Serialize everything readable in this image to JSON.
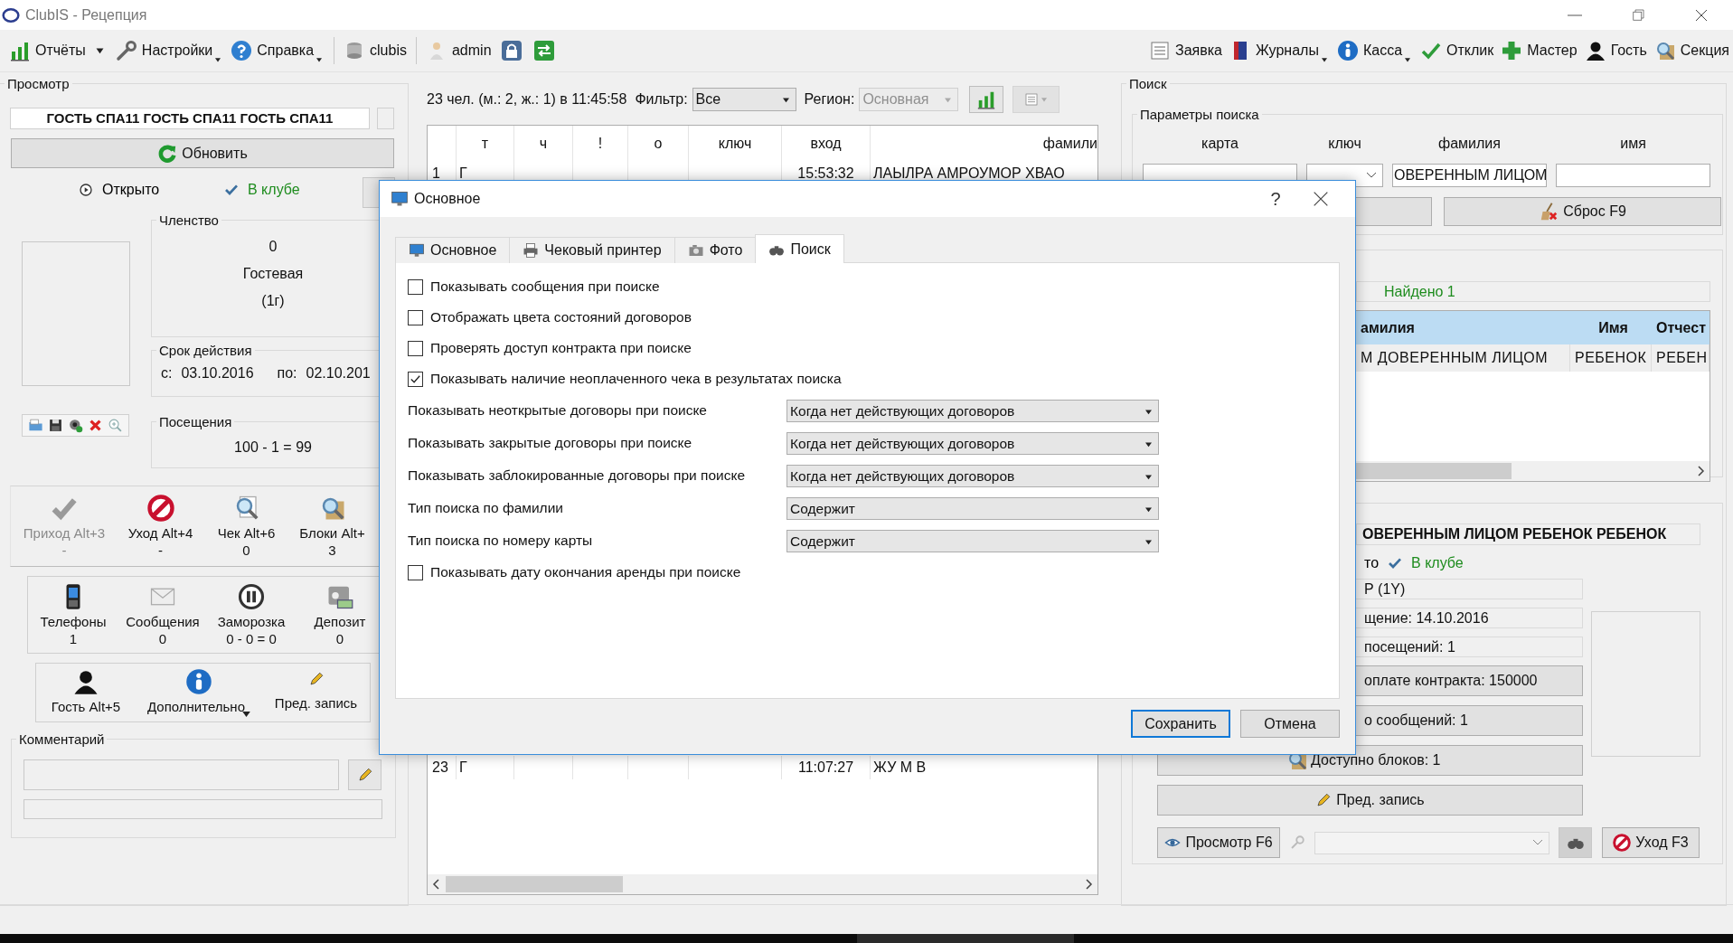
{
  "window": {
    "title": "ClubIS - Рецепция"
  },
  "toolbar_left": [
    {
      "label": "Отчёты",
      "menu": true
    },
    {
      "label": "Настройки",
      "menu": true
    },
    {
      "label": "Справка",
      "menu": true
    },
    {
      "label": "clubis",
      "menu": false
    },
    {
      "label": "admin",
      "menu": false
    }
  ],
  "toolbar_right": [
    {
      "label": "Заявка",
      "menu": false
    },
    {
      "label": "Журналы",
      "menu": true
    },
    {
      "label": "Касса",
      "menu": true
    },
    {
      "label": "Отклик",
      "menu": false
    },
    {
      "label": "Мастер",
      "menu": false
    },
    {
      "label": "Гость",
      "menu": false
    },
    {
      "label": "Секция",
      "menu": false
    }
  ],
  "view": {
    "title": "Просмотр",
    "name": "ГОСТЬ СПА11 ГОСТЬ СПА11 ГОСТЬ СПА11",
    "refresh": "Обновить",
    "status": [
      {
        "label": "Открыто",
        "color": "#000000"
      },
      {
        "label": "В клубе",
        "color": "#1e8c1e"
      }
    ],
    "membership": {
      "title": "Членство",
      "lines": [
        "0",
        "Гостевая",
        "(1г)"
      ]
    },
    "validity": {
      "title": "Срок действия",
      "from_label": "с:",
      "from": "03.10.2016",
      "to_label": "по:",
      "to": "02.10.201"
    },
    "visits": {
      "title": "Посещения",
      "value": "100 - 1 = 99"
    },
    "actions": [
      {
        "label": "Приход Alt+3",
        "value": "-",
        "disabled": true
      },
      {
        "label": "Уход Alt+4",
        "value": "-",
        "disabled": false
      },
      {
        "label": "Чек Alt+6",
        "value": "0",
        "disabled": false
      },
      {
        "label": "Блоки Alt+",
        "value": "3",
        "disabled": false
      }
    ],
    "info": [
      {
        "label": "Телефоны",
        "value": "1"
      },
      {
        "label": "Сообщения",
        "value": "0"
      },
      {
        "label": "Заморозка",
        "value": "0 - 0 = 0"
      },
      {
        "label": "Депозит",
        "value": "0"
      }
    ],
    "extra": [
      {
        "label": "Гость Alt+5",
        "menu": false
      },
      {
        "label": "Дополнительно",
        "menu": true
      },
      {
        "label": "Пред. запись",
        "menu": false
      }
    ],
    "comment": {
      "title": "Комментарий"
    }
  },
  "visitors": {
    "summary": "23 чел. (м.: 2, ж.: 1) в 11:45:58",
    "filter_label": "Фильтр:",
    "filter": "Все",
    "region_label": "Регион:",
    "region": {
      "value": "Основная",
      "disabled": true
    },
    "columns": [
      "т",
      "ч",
      "!",
      "о",
      "ключ",
      "вход",
      "фамили"
    ],
    "rows": [
      {
        "number": "1",
        "t": "Г",
        "entry": "15:53:32",
        "surname": "ЛАЫЛРА АМРОУМОР ХВАО"
      },
      {
        "number": "23",
        "t": "Г",
        "entry": "11:07:27",
        "surname": "ЖУ М В"
      }
    ]
  },
  "search": {
    "title": "Поиск",
    "params_title": "Параметры поиска",
    "fields": [
      {
        "label": "карта",
        "kind": "text"
      },
      {
        "label": "ключ",
        "kind": "combo"
      },
      {
        "label": "фамилия",
        "kind": "text",
        "value": "ОВЕРЕННЫМ ЛИЦОМ"
      },
      {
        "label": "имя",
        "kind": "text"
      }
    ],
    "reset": "Сброс F9",
    "found": "Найдено 1",
    "results": {
      "columns": [
        "амилия",
        "Имя",
        "Отчест"
      ],
      "rows": [
        [
          "М ДОВЕРЕННЫМ ЛИЦОМ",
          "РЕБЕНОК",
          "РЕБЕН"
        ]
      ]
    },
    "card": {
      "name": "ОВЕРЕННЫМ ЛИЦОМ РЕБЕНОК РЕБЕНОК",
      "status": [
        {
          "label": "то",
          "color": "#000000"
        },
        {
          "label": "В клубе",
          "color": "#1e8c1e"
        }
      ],
      "fields": [
        "Р (1Y)",
        "щение: 14.10.2016",
        "посещений: 1"
      ],
      "buttons": [
        "оплате контракта: 150000",
        "о сообщений: 1",
        "Доступно  блоков: 1",
        "Пред. запись"
      ],
      "view": "Просмотр F6",
      "leave": "Уход F3"
    }
  },
  "dialog": {
    "title": "Основное",
    "help": "?",
    "tabs": [
      {
        "label": "Основное",
        "selected": false
      },
      {
        "label": "Чековый принтер",
        "selected": false
      },
      {
        "label": "Фото",
        "selected": false
      },
      {
        "label": "Поиск",
        "selected": true
      }
    ],
    "options": [
      {
        "kind": "checkbox",
        "label": "Показывать сообщения при поиске",
        "checked": false
      },
      {
        "kind": "checkbox",
        "label": "Отображать цвета состояний договоров",
        "checked": false
      },
      {
        "kind": "checkbox",
        "label": "Проверять доступ контракта при поиске",
        "checked": false
      },
      {
        "kind": "checkbox",
        "label": "Показывать наличие неоплаченного чека в результатах поиска",
        "checked": true
      },
      {
        "kind": "select",
        "label": "Показывать неоткрытые договоры при поиске",
        "value": "Когда нет действующих договоров"
      },
      {
        "kind": "select",
        "label": "Показывать закрытые договоры при поиске",
        "value": "Когда нет действующих договоров"
      },
      {
        "kind": "select",
        "label": "Показывать заблокированные договоры при поиске",
        "value": "Когда нет действующих договоров"
      },
      {
        "kind": "select",
        "label": "Тип поиска по фамилии",
        "value": "Содержит"
      },
      {
        "kind": "select",
        "label": "Тип поиска по номеру карты",
        "value": "Содержит"
      },
      {
        "kind": "checkbox",
        "label": "Показывать дату окончания аренды при поиске",
        "checked": false
      }
    ],
    "buttons": [
      {
        "label": "Сохранить",
        "default": true
      },
      {
        "label": "Отмена",
        "default": false
      }
    ]
  }
}
